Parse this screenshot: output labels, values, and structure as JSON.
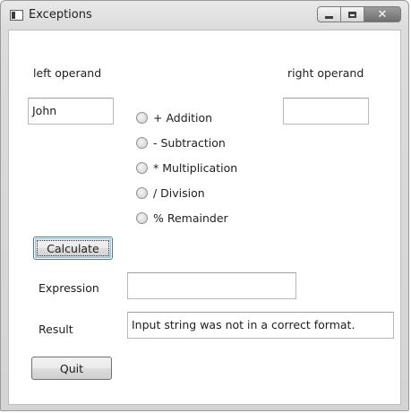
{
  "window": {
    "title": "Exceptions"
  },
  "form": {
    "left_operand_label": "left operand",
    "right_operand_label": "right operand",
    "left_operand_value": "John",
    "right_operand_value": "",
    "operations": [
      {
        "label": "+ Addition",
        "selected": false
      },
      {
        "label": "- Subtraction",
        "selected": false
      },
      {
        "label": "* Multiplication",
        "selected": false
      },
      {
        "label": "/ Division",
        "selected": false
      },
      {
        "label": "% Remainder",
        "selected": false
      }
    ],
    "calculate_label": "Calculate",
    "expression_label": "Expression",
    "expression_value": "",
    "result_label": "Result",
    "result_value": "Input string was not in a correct format.",
    "quit_label": "Quit"
  },
  "icons": {
    "app": "app-window-icon",
    "minimize": "minimize-icon",
    "maximize": "maximize-icon",
    "close": "close-icon"
  }
}
